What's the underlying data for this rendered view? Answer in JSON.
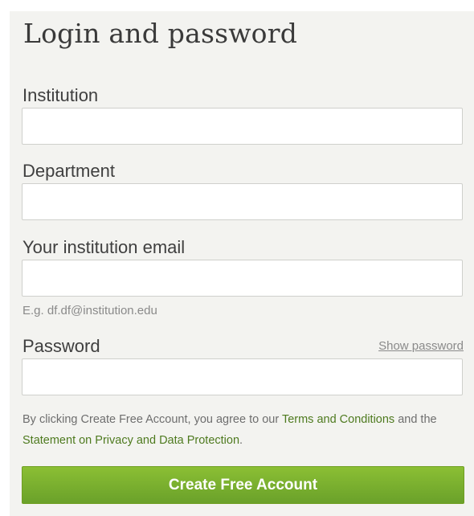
{
  "form": {
    "title": "Login and password",
    "institution": {
      "label": "Institution",
      "value": "",
      "placeholder": ""
    },
    "department": {
      "label": "Department",
      "value": "",
      "placeholder": ""
    },
    "email": {
      "label": "Your institution email",
      "value": "",
      "placeholder": "",
      "hint": "E.g. df.df@institution.edu"
    },
    "password": {
      "label": "Password",
      "value": "",
      "placeholder": "",
      "show_label": "Show password"
    },
    "terms": {
      "prefix": "By clicking Create Free Account, you agree to our ",
      "terms_link": "Terms and Conditions",
      "middle": " and the ",
      "privacy_link": "Statement on Privacy and Data Protection",
      "suffix": "."
    },
    "submit_label": "Create Free Account"
  },
  "colors": {
    "panel_bg": "#f3f3f0",
    "button_green": "#7ab32f",
    "link_green": "#4e7a1f",
    "text_dark": "#3f3f3f",
    "text_muted": "#8a8a8a"
  }
}
